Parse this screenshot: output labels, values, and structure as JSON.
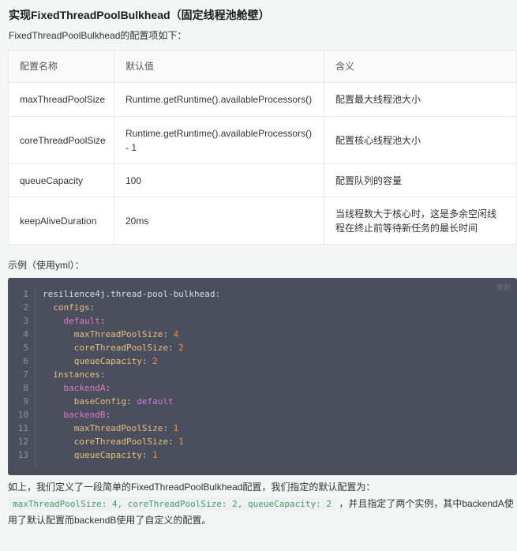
{
  "heading": "实现FixedThreadPoolBulkhead（固定线程池舱壁）",
  "intro": "FixedThreadPoolBulkhead的配置项如下：",
  "table": {
    "headers": [
      "配置名称",
      "默认值",
      "含义"
    ],
    "rows": [
      [
        "maxThreadPoolSize",
        "Runtime.getRuntime().availableProcessors()",
        "配置最大线程池大小"
      ],
      [
        "coreThreadPoolSize",
        "Runtime.getRuntime().availableProcessors() - 1",
        "配置核心线程池大小"
      ],
      [
        "queueCapacity",
        "100",
        "配置队列的容量"
      ],
      [
        "keepAliveDuration",
        "20ms",
        "当线程数大于核心时，这是多余空闲线程在终止前等待新任务的最长时间"
      ]
    ]
  },
  "example_label": "示例（使用yml）：",
  "code": {
    "copy_label": "复制",
    "lines": [
      {
        "n": "1",
        "indent": "",
        "key": "resilience4j.thread-pool-bulkhead",
        "level": "root",
        "value": ""
      },
      {
        "n": "2",
        "indent": "  ",
        "key": "configs",
        "level": "k1",
        "value": ""
      },
      {
        "n": "3",
        "indent": "    ",
        "key": "default",
        "level": "k2",
        "value": ""
      },
      {
        "n": "4",
        "indent": "      ",
        "key": "maxThreadPoolSize",
        "level": "k3",
        "value": "4"
      },
      {
        "n": "5",
        "indent": "      ",
        "key": "coreThreadPoolSize",
        "level": "k3",
        "value": "2"
      },
      {
        "n": "6",
        "indent": "      ",
        "key": "queueCapacity",
        "level": "k3",
        "value": "2"
      },
      {
        "n": "7",
        "indent": "  ",
        "key": "instances",
        "level": "k1",
        "value": ""
      },
      {
        "n": "8",
        "indent": "    ",
        "key": "backendA",
        "level": "k2",
        "value": ""
      },
      {
        "n": "9",
        "indent": "      ",
        "key": "baseConfig",
        "level": "k3",
        "value": "default"
      },
      {
        "n": "10",
        "indent": "    ",
        "key": "backendB",
        "level": "k2",
        "value": ""
      },
      {
        "n": "11",
        "indent": "      ",
        "key": "maxThreadPoolSize",
        "level": "k3",
        "value": "1"
      },
      {
        "n": "12",
        "indent": "      ",
        "key": "coreThreadPoolSize",
        "level": "k3",
        "value": "1"
      },
      {
        "n": "13",
        "indent": "      ",
        "key": "queueCapacity",
        "level": "k3",
        "value": "1"
      }
    ]
  },
  "summary": {
    "line1": "如上，我们定义了一段简单的FixedThreadPoolBulkhead配置，我们指定的默认配置为：",
    "inline_code": "maxThreadPoolSize: 4, coreThreadPoolSize: 2, queueCapacity: 2",
    "after_code": "，并且指定了两个实例，其中backendA使",
    "line3": "用了默认配置而backendB使用了自定义的配置。"
  },
  "colors": {
    "code_bg": "#4a4e5d",
    "inline_code_text": "#3e9f63"
  }
}
